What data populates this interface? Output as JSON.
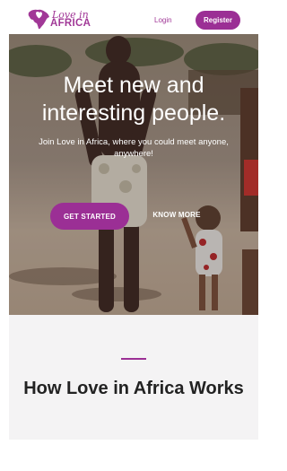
{
  "header": {
    "logo_line1": "Love in",
    "logo_line2": "AFRICA",
    "login_label": "Login",
    "register_label": "Register"
  },
  "hero": {
    "title": "Meet new and interesting people.",
    "subtitle": "Join Love in Africa, where you could meet anyone, anywhere!",
    "primary_cta": "GET STARTED",
    "secondary_cta": "KNOW MORE"
  },
  "how": {
    "title": "How Love in Africa Works"
  },
  "colors": {
    "brand": "#9b2f95",
    "brand_text": "#a13897",
    "section_bg": "#f4f3f4"
  },
  "icons": {
    "logo": "africa-map-logo-icon"
  }
}
